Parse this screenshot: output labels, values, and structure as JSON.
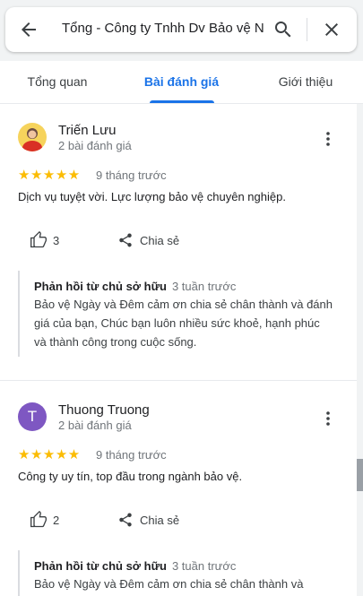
{
  "search": {
    "query": "Tổng - Công ty Tnhh Dv Bảo vệ N"
  },
  "tabs": [
    {
      "label": "Tổng quan"
    },
    {
      "label": "Bài đánh giá"
    },
    {
      "label": "Giới thiệu"
    }
  ],
  "reviews": [
    {
      "name": "Triến Lưu",
      "count": "2 bài đánh giá",
      "stars": "★★★★★",
      "time": "9 tháng trước",
      "text": "Dịch vụ tuyệt vời. Lực lượng bảo vệ chuyên nghiệp.",
      "likes": "3",
      "share": "Chia sẻ",
      "reply_title": "Phản hồi từ chủ sở hữu",
      "reply_time": "3 tuần trước",
      "reply_text": "Bảo vệ Ngày và Đêm cảm ơn chia sẻ chân thành và đánh giá của bạn, Chúc bạn luôn nhiều sức khoẻ, hạnh phúc và thành công trong cuộc sống."
    },
    {
      "name": "Thuong Truong",
      "initial": "T",
      "count": "2 bài đánh giá",
      "stars": "★★★★★",
      "time": "9 tháng trước",
      "text": "Công ty uy tín, top đầu trong ngành bảo vệ.",
      "likes": "2",
      "share": "Chia sẻ",
      "reply_title": "Phản hồi từ chủ sở hữu",
      "reply_time": "3 tuần trước",
      "reply_text": "Bảo vệ Ngày và Đêm cảm ơn chia sẻ chân thành và"
    }
  ],
  "colors": {
    "accent": "#1a73e8",
    "star": "#fbbc04",
    "avatar_purple": "#7e57c2"
  }
}
